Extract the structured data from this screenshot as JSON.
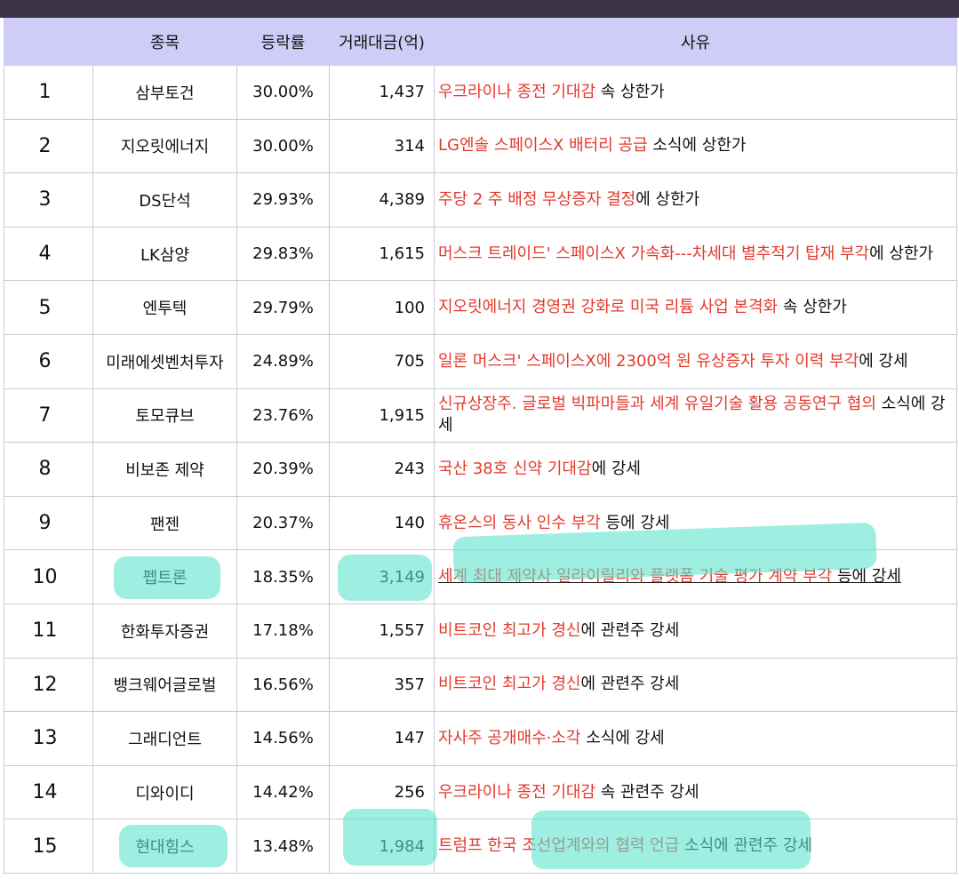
{
  "header": {
    "col_name": "종목",
    "col_rate": "등락률",
    "col_volume": "거래대금(억)",
    "col_reason": "사유"
  },
  "rows": [
    {
      "rank": "1",
      "name": "삼부토건",
      "rate": "30.00%",
      "volume": "1,437",
      "reason_hl": "우크라이나 종전 기대감",
      "reason_rest": " 속 상한가"
    },
    {
      "rank": "2",
      "name": "지오릿에너지",
      "rate": "30.00%",
      "volume": "314",
      "reason_hl": "LG엔솔 스페이스X 배터리 공급",
      "reason_rest": " 소식에 상한가"
    },
    {
      "rank": "3",
      "name": "DS단석",
      "rate": "29.93%",
      "volume": "4,389",
      "reason_hl": "주당 2 주 배정 무상증자 결정",
      "reason_rest": "에 상한가"
    },
    {
      "rank": "4",
      "name": "LK삼양",
      "rate": "29.83%",
      "volume": "1,615",
      "reason_hl": "머스크 트레이드' 스페이스X 가속화---차세대 별추적기 탑재 부각",
      "reason_rest": "에 상한가"
    },
    {
      "rank": "5",
      "name": "엔투텍",
      "rate": "29.79%",
      "volume": "100",
      "reason_hl": "지오릿에너지 경영권 강화로 미국 리튬 사업 본격화",
      "reason_rest": " 속 상한가"
    },
    {
      "rank": "6",
      "name": "미래에셋벤처투자",
      "rate": "24.89%",
      "volume": "705",
      "reason_hl": "일론 머스크' 스페이스X에 2300억 원 유상증자 투자 이력 부각",
      "reason_rest": "에 강세"
    },
    {
      "rank": "7",
      "name": "토모큐브",
      "rate": "23.76%",
      "volume": "1,915",
      "reason_hl": "신규상장주. 글로벌 빅파마들과 세계 유일기술 활용 공동연구 협의",
      "reason_rest": " 소식에 강세"
    },
    {
      "rank": "8",
      "name": "비보존 제약",
      "rate": "20.39%",
      "volume": "243",
      "reason_hl": "국산 38호 신약 기대감",
      "reason_rest": "에 강세"
    },
    {
      "rank": "9",
      "name": "팬젠",
      "rate": "20.37%",
      "volume": "140",
      "reason_hl": "휴온스의 동사 인수 부각",
      "reason_rest": " 등에 강세"
    },
    {
      "rank": "10",
      "name": "펩트론",
      "rate": "18.35%",
      "volume": "3,149",
      "reason_hl": "세계 최대 제약사 일라이릴리와 플랫폼 기술 평가 계약 부각",
      "reason_rest": " 등에 강세"
    },
    {
      "rank": "11",
      "name": "한화투자증권",
      "rate": "17.18%",
      "volume": "1,557",
      "reason_hl": "비트코인 최고가 경신",
      "reason_rest": "에 관련주 강세"
    },
    {
      "rank": "12",
      "name": "뱅크웨어글로벌",
      "rate": "16.56%",
      "volume": "357",
      "reason_hl": "비트코인 최고가 경신",
      "reason_rest": "에 관련주 강세"
    },
    {
      "rank": "13",
      "name": "그래디언트",
      "rate": "14.56%",
      "volume": "147",
      "reason_hl": "자사주 공개매수·소각",
      "reason_rest": " 소식에 강세"
    },
    {
      "rank": "14",
      "name": "디와이디",
      "rate": "14.42%",
      "volume": "256",
      "reason_hl": "우크라이나 종전 기대감",
      "reason_rest": " 속 관련주 강세"
    },
    {
      "rank": "15",
      "name": "현대힘스",
      "rate": "13.48%",
      "volume": "1,984",
      "reason_hl": "트럼프 한국 조선업계와의 협력 언급",
      "reason_rest": " 소식에 관련주 강세"
    }
  ],
  "colors": {
    "header_bg": "#cfcdf7",
    "highlight_text": "#e23a2d",
    "marker": "#5fe3cf",
    "top_bar": "#3b3448"
  }
}
